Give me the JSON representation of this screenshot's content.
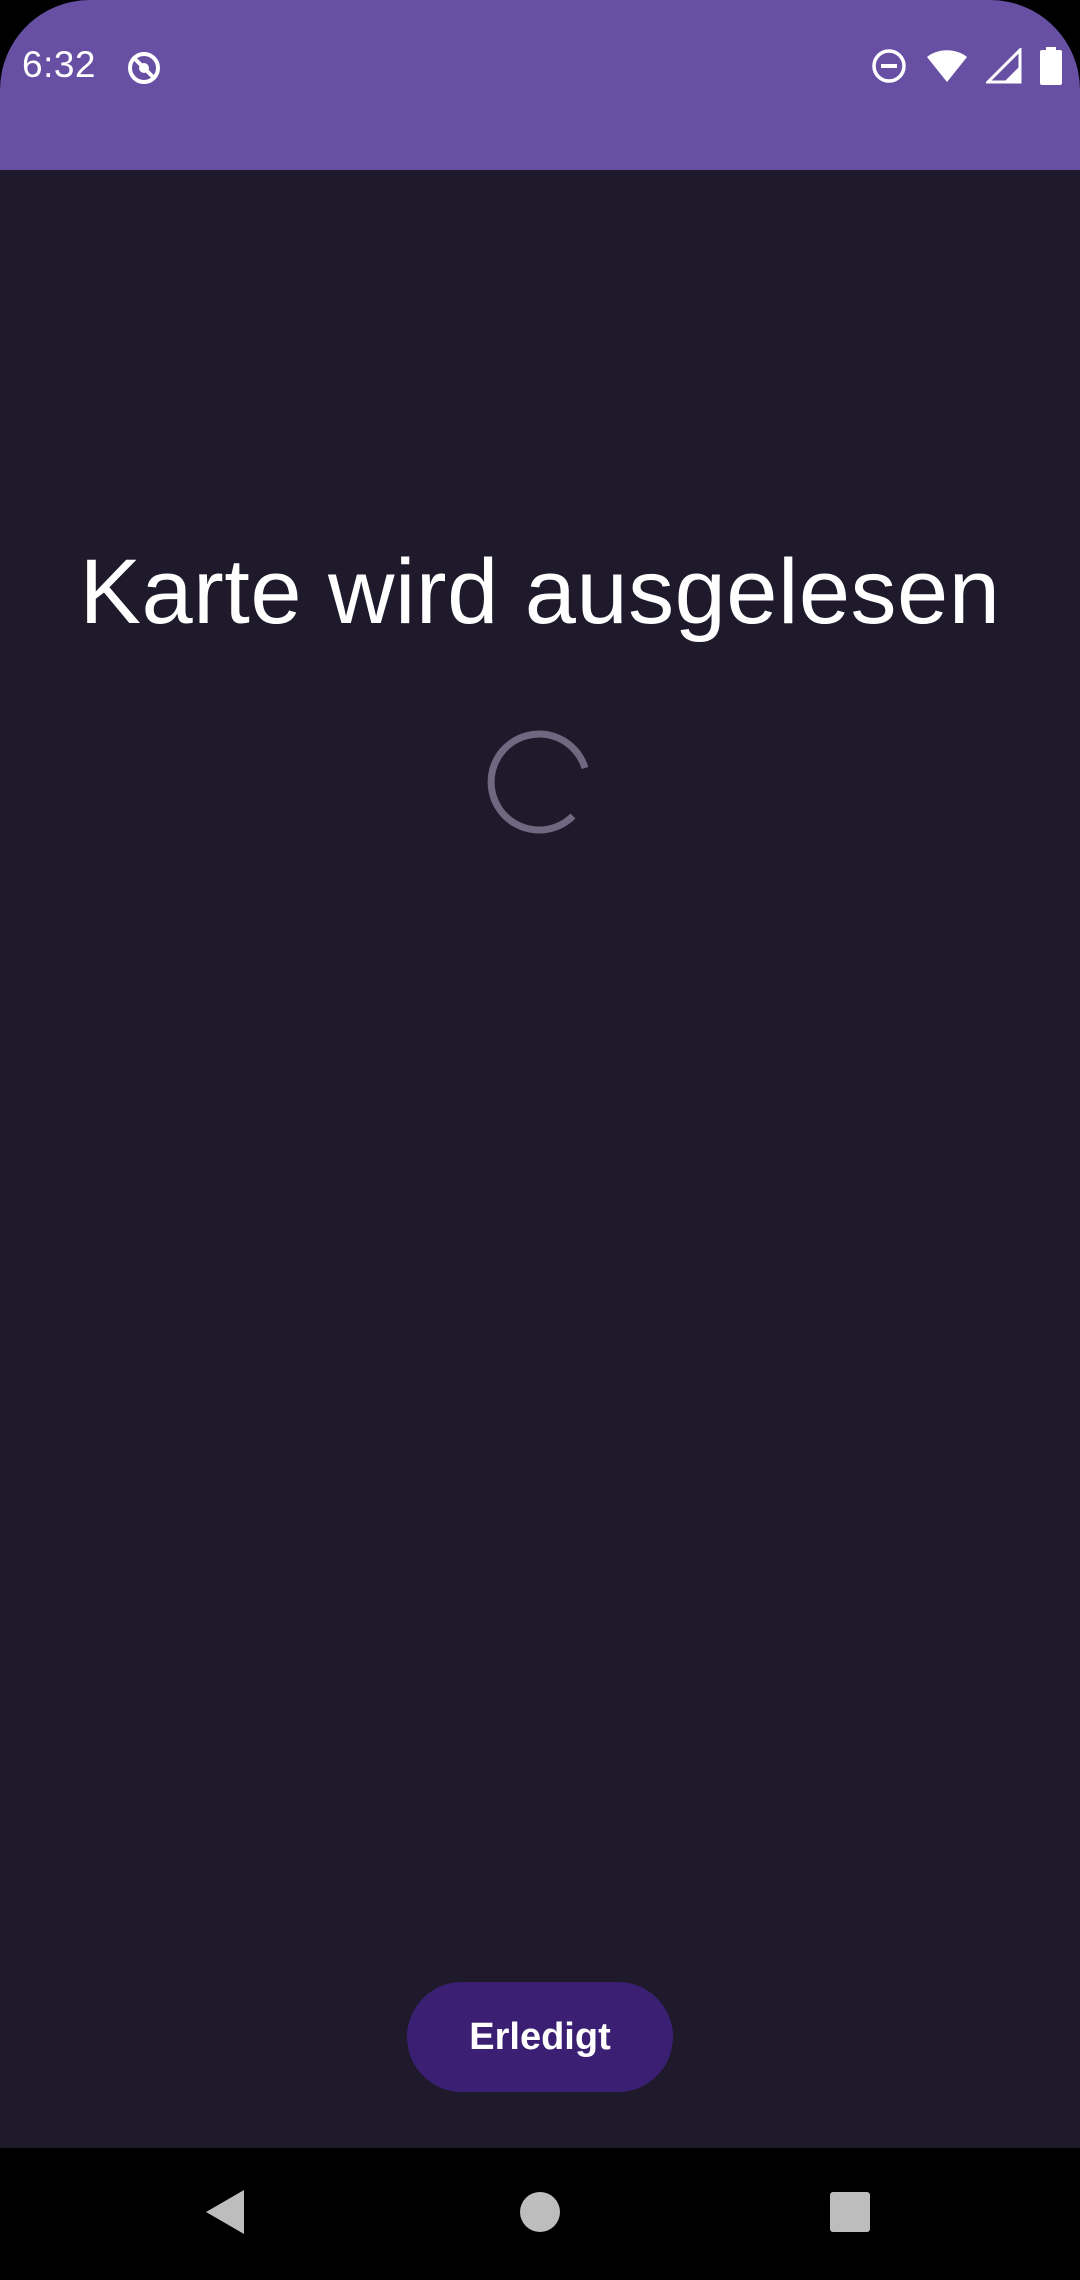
{
  "status_bar": {
    "time": "6:32",
    "left_icons": [
      "sync-disabled-icon"
    ],
    "right_icons": [
      "do-not-disturb-icon",
      "wifi-icon",
      "signal-icon",
      "battery-icon"
    ],
    "color": "#6750A4"
  },
  "main": {
    "title": "Karte wird ausgelesen",
    "loading": true,
    "background_color": "#1E1A2B"
  },
  "actions": {
    "done_label": "Erledigt",
    "done_color": "#3A1F73"
  },
  "navigation": {
    "buttons": [
      "back",
      "home",
      "recents"
    ]
  }
}
